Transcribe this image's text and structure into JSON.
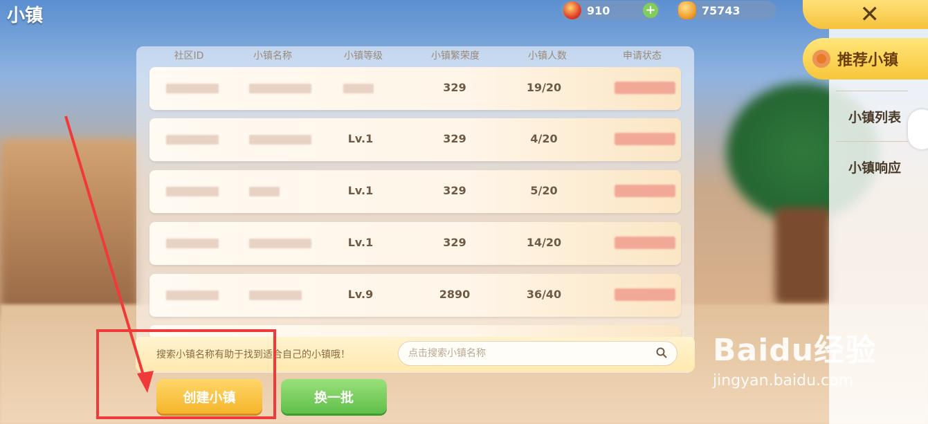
{
  "title": "小镇",
  "currency": {
    "gems": "910",
    "gems_plus": "+",
    "coins": "75743"
  },
  "close_label": "✕",
  "sidebar": {
    "active": "推荐小镇",
    "items": [
      {
        "label": "小镇列表"
      },
      {
        "label": "小镇响应"
      }
    ]
  },
  "table": {
    "headers": [
      "社区ID",
      "小镇名称",
      "小镇等级",
      "小镇繁荣度",
      "小镇人数",
      "申请状态"
    ],
    "rows": [
      {
        "id": "",
        "name": "",
        "level": "",
        "prosperity": "329",
        "members": "19/20",
        "status": ""
      },
      {
        "id": "",
        "name": "",
        "level": "Lv.1",
        "prosperity": "329",
        "members": "4/20",
        "status": ""
      },
      {
        "id": "",
        "name": "",
        "level": "Lv.1",
        "prosperity": "329",
        "members": "5/20",
        "status": ""
      },
      {
        "id": "",
        "name": "",
        "level": "Lv.1",
        "prosperity": "329",
        "members": "14/20",
        "status": ""
      },
      {
        "id": "",
        "name": "",
        "level": "Lv.9",
        "prosperity": "2890",
        "members": "36/40",
        "status": ""
      }
    ]
  },
  "search": {
    "tip": "搜索小镇名称有助于找到适合自己的小镇哦！",
    "placeholder": "点击搜索小镇名称"
  },
  "buttons": {
    "create": "创建小镇",
    "refresh": "换一批"
  },
  "watermark": {
    "logo": "Baidu经验",
    "url": "jingyan.baidu.com"
  },
  "colors": {
    "accent_yellow": "#f7c63a",
    "green_button": "#5fbf4a",
    "annotation_red": "#f03a3a"
  }
}
